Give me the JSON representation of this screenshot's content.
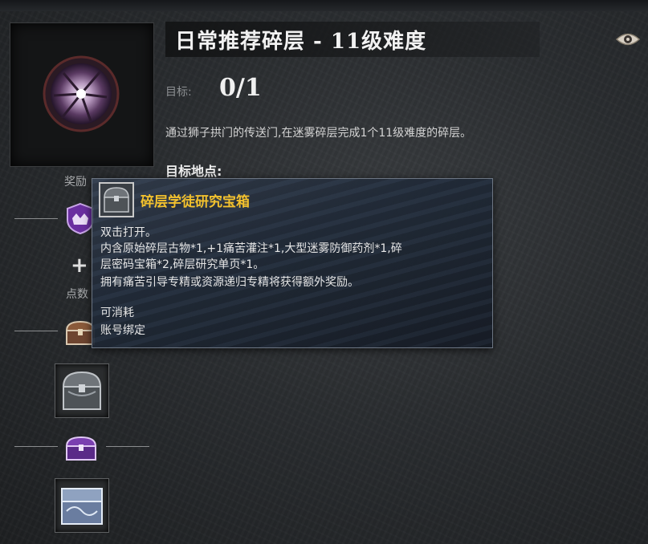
{
  "quest": {
    "title": "日常推荐碎层 - 11级难度",
    "goal_label": "目标:",
    "goal_value": "0/1",
    "description": "通过狮子拱门的传送门,在迷雾碎层完成1个11级难度的碎层。",
    "location_label": "目标地点:"
  },
  "sidebar": {
    "rewards_label": "奖励",
    "points_label": "点数",
    "plus_symbol": "+"
  },
  "tooltip": {
    "item_name": "碎层学徒研究宝箱",
    "lines": [
      "双击打开。",
      "内含原始碎层古物*1,+1痛苦灌注*1,大型迷雾防御药剂*1,碎",
      "层密码宝箱*2,碎层研究单页*1。",
      "拥有痛苦引导专精或资源递归专精将获得额外奖励。",
      "",
      "可消耗",
      "账号绑定"
    ]
  },
  "icons": {
    "portrait": "shard-orb-icon",
    "eye": "eye-icon",
    "crest": "purple-crest-icon",
    "chest": "treasure-chest-icon",
    "purple_chest": "purple-chest-icon",
    "ornate_chest": "ornate-chest-icon"
  },
  "colors": {
    "item_name": "#f2c12e",
    "crest": "#7a3fb0"
  }
}
